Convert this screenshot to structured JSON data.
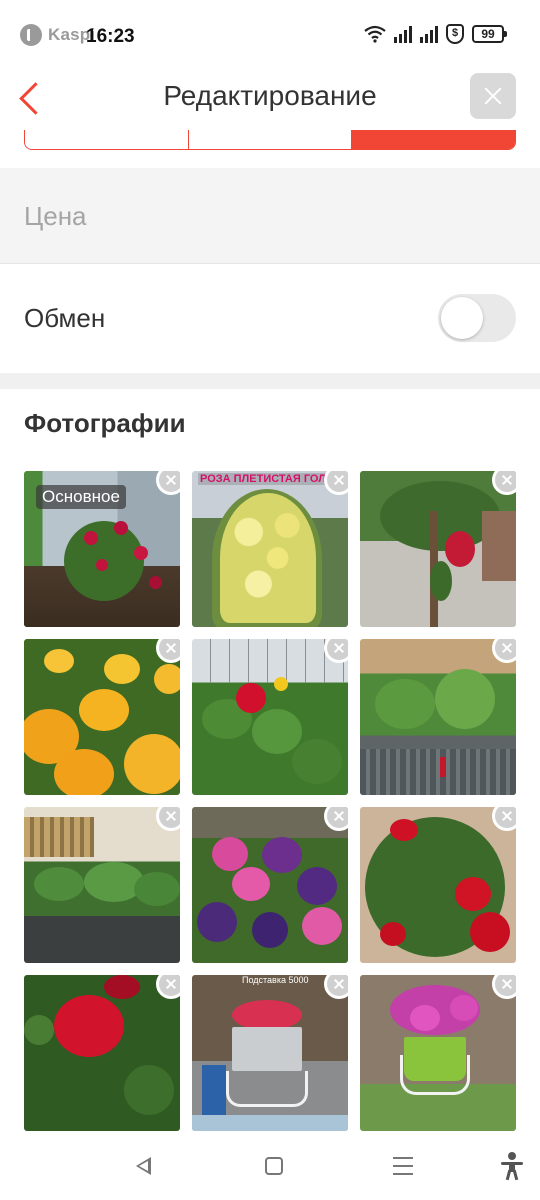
{
  "status_bar": {
    "app_name": "Kaspi",
    "time": "16:23",
    "battery": "99"
  },
  "header": {
    "title": "Редактирование"
  },
  "price": {
    "placeholder": "Цена"
  },
  "exchange": {
    "label": "Обмен",
    "enabled": false
  },
  "photos": {
    "title": "Фотографии",
    "main_badge": "Основное",
    "items": [
      {
        "subject": "red-roses-garden",
        "caption": ""
      },
      {
        "subject": "yellow-climbing-rose",
        "caption": "РОЗА ПЛЕТИСТАЯ ГОЛДЕН КО"
      },
      {
        "subject": "tree-with-roses",
        "caption": ""
      },
      {
        "subject": "orange-marigolds",
        "caption": ""
      },
      {
        "subject": "red-zinnia-seedlings",
        "caption": ""
      },
      {
        "subject": "tomato-seedlings-crates",
        "caption": ""
      },
      {
        "subject": "seedlings-pots",
        "caption": ""
      },
      {
        "subject": "pink-purple-petunias",
        "caption": ""
      },
      {
        "subject": "red-rose-bush",
        "caption": ""
      },
      {
        "subject": "red-rose-closeup",
        "caption": ""
      },
      {
        "subject": "hanging-basket-red",
        "caption": "Подставка 5000"
      },
      {
        "subject": "hanging-basket-pink",
        "caption": ""
      }
    ]
  },
  "colors": {
    "accent": "#f14635"
  }
}
